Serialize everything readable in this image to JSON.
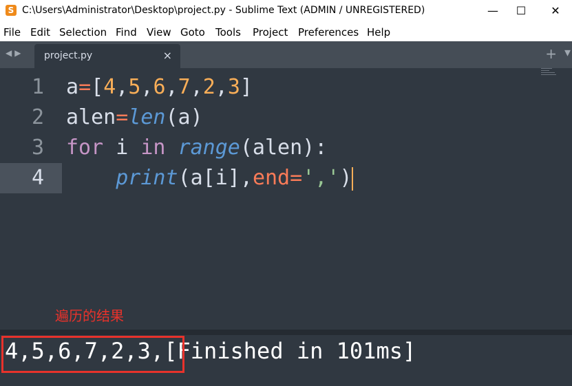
{
  "window": {
    "title": "C:\\Users\\Administrator\\Desktop\\project.py - Sublime Text (ADMIN / UNREGISTERED)",
    "app_icon_glyph": "S",
    "app_icon": "sublime-logo-icon",
    "minimize": "—",
    "maximize": "☐",
    "close": "✕"
  },
  "menu": {
    "items": [
      {
        "label": "File"
      },
      {
        "label": "Edit"
      },
      {
        "label": "Selection"
      },
      {
        "label": "Find"
      },
      {
        "label": "View"
      },
      {
        "label": "Goto"
      },
      {
        "label": "Tools"
      },
      {
        "label": "Project"
      },
      {
        "label": "Preferences"
      },
      {
        "label": "Help"
      }
    ]
  },
  "tabs": {
    "nav_prev": "◀",
    "nav_next": "▶",
    "active": {
      "label": "project.py",
      "close": "×"
    },
    "add": "+",
    "more": "▾"
  },
  "editor": {
    "lines": [
      {
        "number": "1",
        "text": "a=[4,5,6,7,2,3]"
      },
      {
        "number": "2",
        "text": "alen=len(a)"
      },
      {
        "number": "3",
        "text": "for i in range(alen):"
      },
      {
        "number": "4",
        "text": "    print(a[i],end=',')",
        "current": true
      }
    ]
  },
  "annotation": {
    "text": "遍历的结果"
  },
  "console": {
    "output": "4,5,6,7,2,3,",
    "status": "[Finished in 101ms]"
  },
  "colors": {
    "background": "#303841",
    "number": "#f9ae58",
    "operator": "#f97b58",
    "function": "#5c99d6",
    "keyword": "#c695c6",
    "string": "#99c794",
    "annotation": "#e8322b"
  }
}
